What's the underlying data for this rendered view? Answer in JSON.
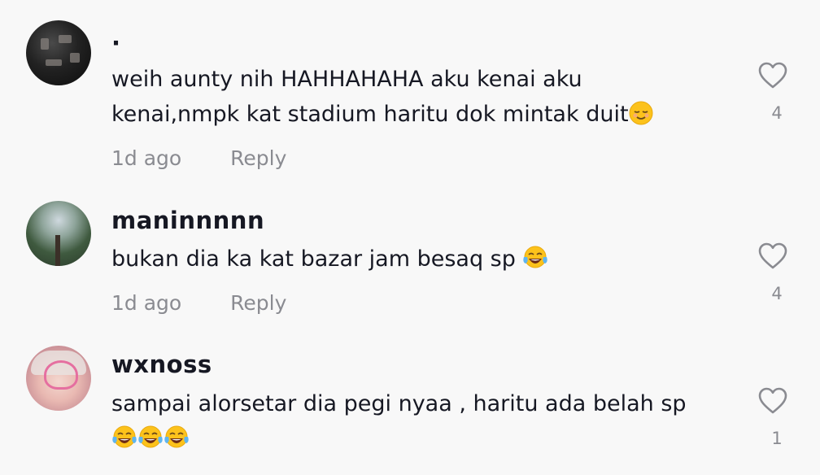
{
  "comments": [
    {
      "username": "·",
      "text_parts": [
        "weih aunty nih HAHHAHAHA aku kenai aku",
        "kenai,nmpk kat stadium haritu dok mintak duit"
      ],
      "emoji": "relieved-face",
      "time": "1d ago",
      "reply_label": "Reply",
      "likes": "4"
    },
    {
      "username": "maninnnnn",
      "text": "bukan dia ka kat bazar jam besaq sp ",
      "emoji": "tears-of-joy",
      "time": "1d ago",
      "reply_label": "Reply",
      "likes": "4"
    },
    {
      "username": "wxnoss",
      "text": "sampai alorsetar dia pegi nyaa , haritu ada belah sp",
      "emoji": "tears-of-joy",
      "emoji_count": 3,
      "time": "",
      "reply_label": "",
      "likes": "1"
    }
  ]
}
